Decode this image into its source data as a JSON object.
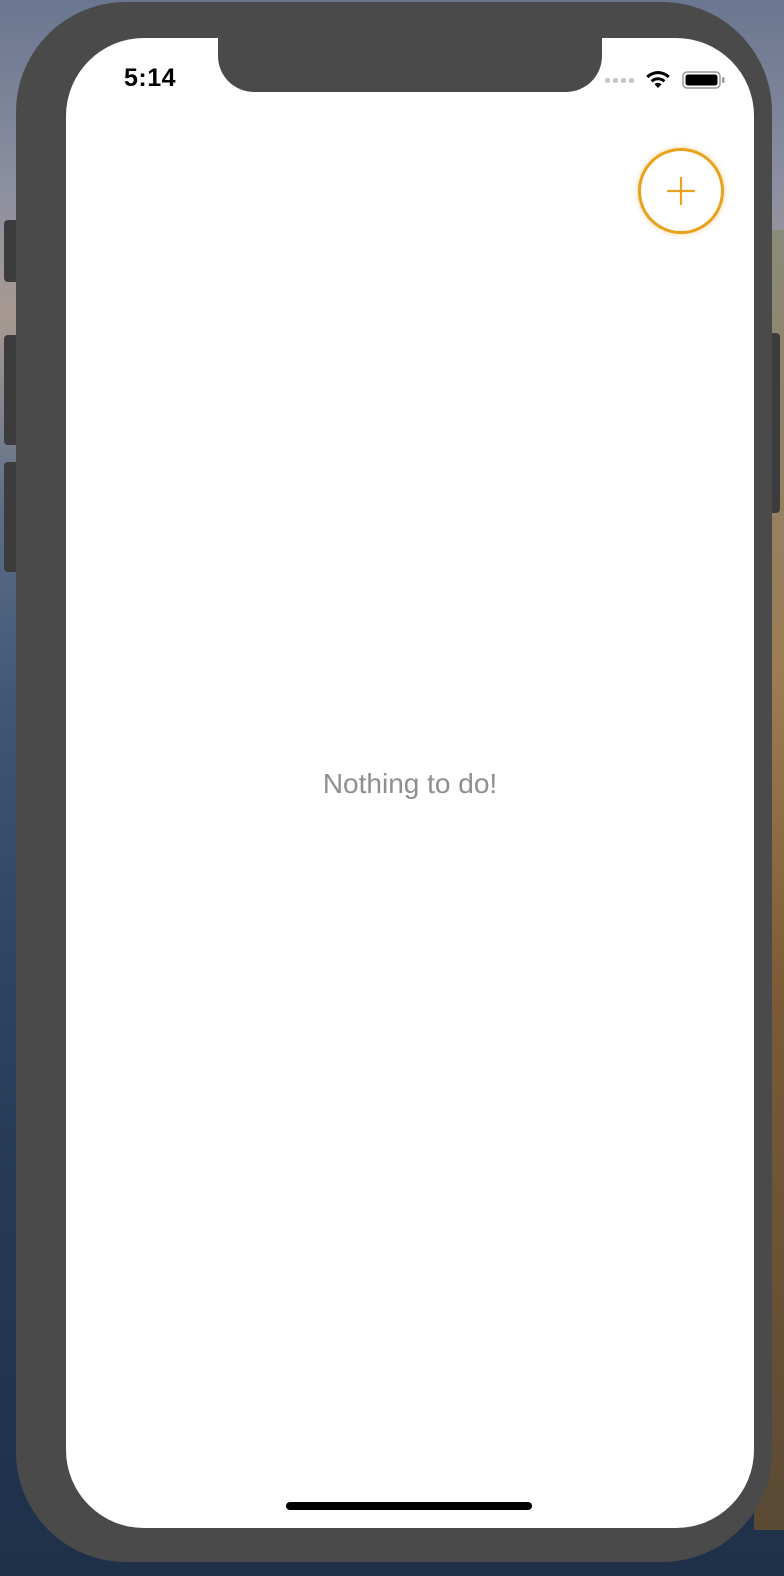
{
  "status_bar": {
    "time": "5:14"
  },
  "toolbar": {
    "add_icon": "plus-icon"
  },
  "empty_state": {
    "message": "Nothing to do!"
  },
  "colors": {
    "accent": "#e8a21c",
    "empty_text": "#8e8e93",
    "frame": "#4a4a4a"
  }
}
